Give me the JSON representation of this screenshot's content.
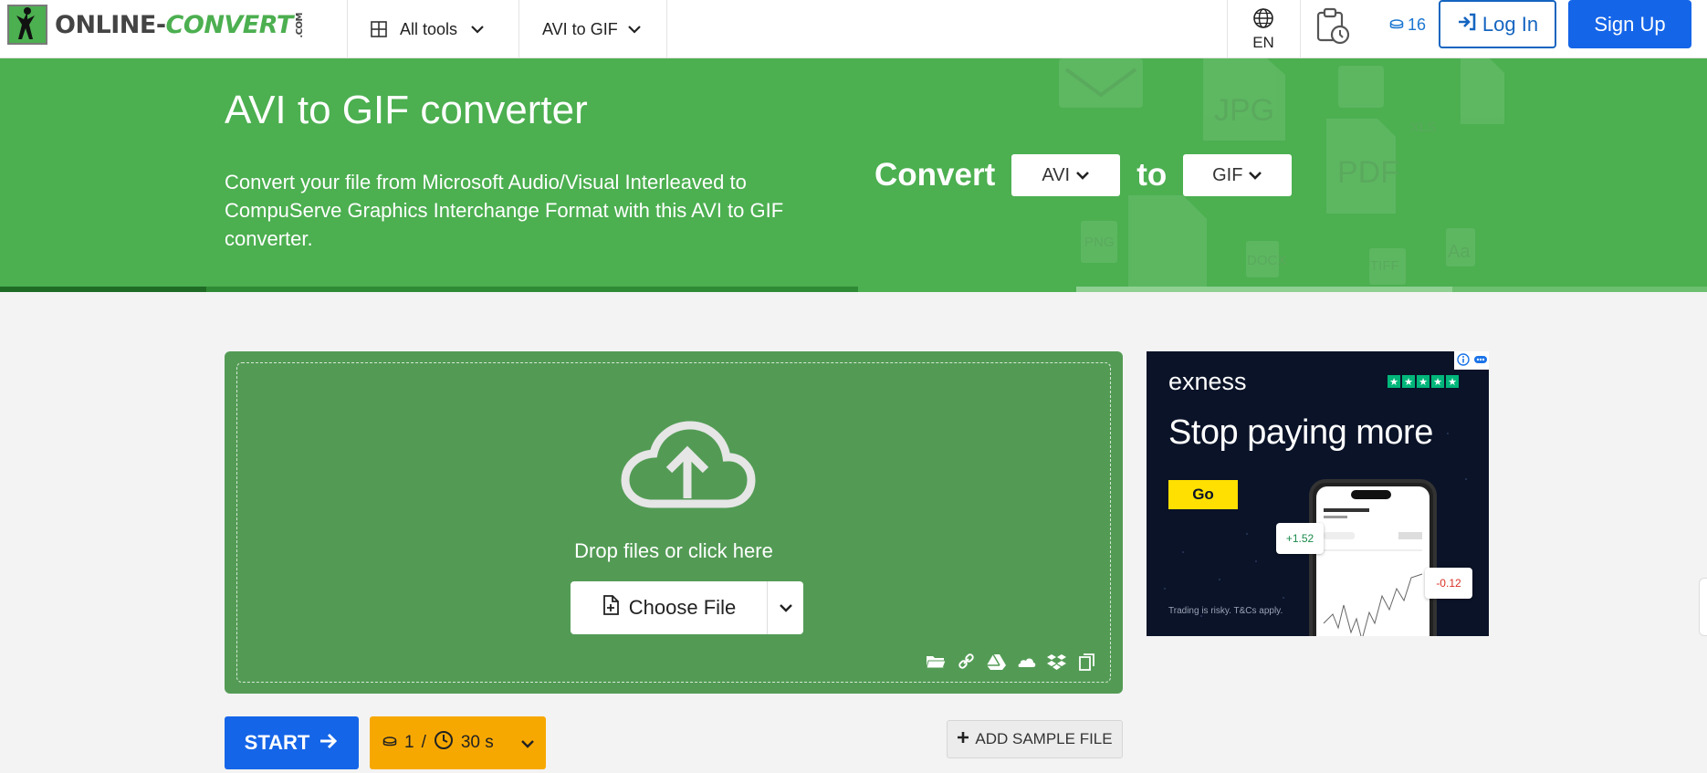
{
  "header": {
    "logo_text_main": "ONLINE-",
    "logo_text_accent": "CONVERT",
    "logo_text_com": ".COM",
    "all_tools_label": "All tools",
    "converter_menu_label": "AVI to GIF",
    "language": "EN",
    "credits": "16",
    "login_label": "Log In",
    "signup_label": "Sign Up"
  },
  "hero": {
    "title": "AVI to GIF converter",
    "description": "Convert your file from Microsoft Audio/Visual Interleaved to CompuServe Graphics Interchange Format with this AVI to GIF converter.",
    "convert_label": "Convert",
    "from_format": "AVI",
    "to_label": "to",
    "to_format": "GIF",
    "bg_icon_labels": [
      "JPG",
      "PDF",
      "XLS",
      "PNG",
      "DOCX",
      "TIFF",
      "Aa"
    ]
  },
  "upload": {
    "drop_text": "Drop files or click here",
    "choose_file_label": "Choose File",
    "sources": [
      "folder-icon",
      "link-icon",
      "google-drive-icon",
      "onedrive-icon",
      "dropbox-icon",
      "clipboard-icon"
    ]
  },
  "actions": {
    "start_label": "START",
    "cost_credits": "1",
    "cost_separator": "/",
    "cost_time": "30 s",
    "add_sample_label": "ADD SAMPLE FILE"
  },
  "ad": {
    "brand": "exness",
    "headline": "Stop paying more",
    "cta": "Go",
    "fine_print": "Trading is risky. T&Cs apply.",
    "chip_up": "+1.52",
    "chip_down": "-0.12"
  },
  "colors": {
    "brand_green": "#4caf50",
    "upload_green": "#539b55",
    "primary_blue": "#1565e8",
    "cost_orange": "#f7a800"
  }
}
